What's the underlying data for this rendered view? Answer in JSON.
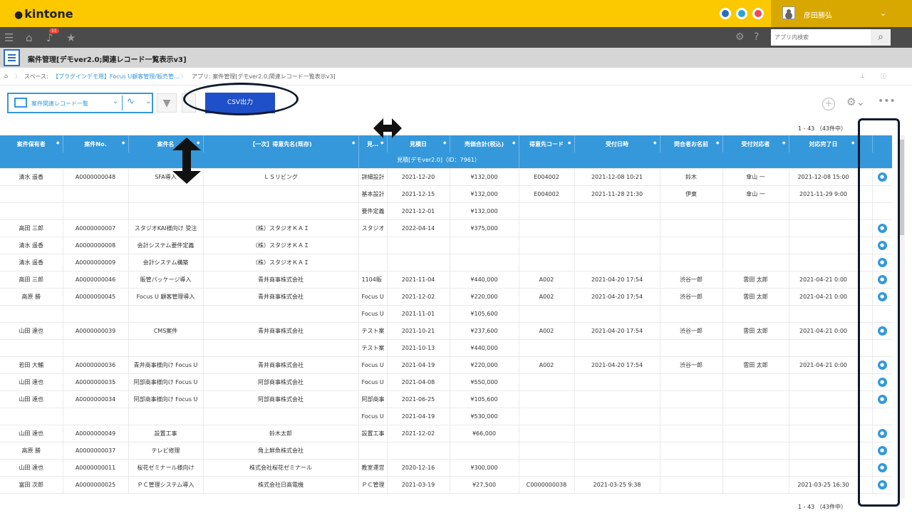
{
  "topbar": {
    "logo": "kintone",
    "user_name": "彦田勝弘",
    "chevron": "⌄"
  },
  "navbar": {
    "badge": "11",
    "search_placeholder": "アプリ内検索"
  },
  "app": {
    "title": "案件管理[デモver2.0;関連レコード一覧表示v3]"
  },
  "breadcrumb": {
    "space_label": "スペース:",
    "space_link": "【プラグインデモ用】Focus U顧客管理/販売管…",
    "app_label": "アプリ: 案件管理[デモver2.0;関連レコード一覧表示v3]"
  },
  "toolbar": {
    "view_name": "案件関連レコード一覧",
    "csv_label": "CSV出力"
  },
  "counts": {
    "top": "1 - 43 （43件中）",
    "bottom": "1 - 43 （43件中）"
  },
  "table": {
    "headers": [
      "案件保有者",
      "案件No.",
      "案件名",
      "↓",
      "【一次】得意先名(既存)",
      "見…",
      "見積日",
      "売価合計(税込)",
      "得意先コード",
      "受付日時",
      "問合者お名前",
      "受付対応者",
      "対応完了日",
      "",
      ""
    ],
    "subheader": "見積[デモver2.0]（ID：7961）",
    "rows": [
      [
        "清水 遥香",
        "A0000000048",
        "SFA導入",
        "",
        "ＬＳリビング",
        "詳細設計",
        "2021-12-20",
        "¥132,000",
        "E004002",
        "2021-12-08 10:21",
        "鈴木",
        "傘山 一",
        "2021-12-08 15:00",
        "",
        "●"
      ],
      [
        "",
        "",
        "",
        "",
        "",
        "基本設計",
        "2021-12-15",
        "¥132,000",
        "E004002",
        "2021-11-28 21:30",
        "伊東",
        "傘山 一",
        "2021-11-29 9:00",
        "",
        ""
      ],
      [
        "",
        "",
        "",
        "",
        "",
        "要件定義",
        "2021-12-01",
        "¥132,000",
        "",
        "",
        "",
        "",
        "",
        "",
        ""
      ],
      [
        "高田 三郎",
        "A0000000007",
        "スタジオKAI様向け 受注",
        "",
        "（株）スタジオＫＡＩ",
        "スタジオ",
        "2022-04-14",
        "¥375,000",
        "",
        "",
        "",
        "",
        "",
        "",
        "●"
      ],
      [
        "清水 遥香",
        "A0000000008",
        "会計システム要件定義",
        "",
        "（株）スタジオＫＡＩ",
        "",
        "",
        "",
        "",
        "",
        "",
        "",
        "",
        "",
        "●"
      ],
      [
        "清水 遥香",
        "A0000000009",
        "会計システム構築",
        "",
        "（株）スタジオＫＡＩ",
        "",
        "",
        "",
        "",
        "",
        "",
        "",
        "",
        "",
        "●"
      ],
      [
        "高田 三郎",
        "A0000000046",
        "販管パッケージ導入",
        "",
        "青井商事株式会社",
        "1104販",
        "2021-11-04",
        "¥440,000",
        "A002",
        "2021-04-20 17:54",
        "渋谷一郎",
        "雲田 太郎",
        "2021-04-21 0:00",
        "",
        "●"
      ],
      [
        "高原 勝",
        "A0000000045",
        "Focus U 顧客管理導入",
        "",
        "青井商事株式会社",
        "Focus U",
        "2021-12-02",
        "¥220,000",
        "A002",
        "2021-04-20 17:54",
        "渋谷一郎",
        "雲田 太郎",
        "2021-04-21 0:00",
        "",
        "●"
      ],
      [
        "",
        "",
        "",
        "",
        "",
        "Focus U",
        "2021-11-01",
        "¥105,600",
        "",
        "",
        "",
        "",
        "",
        "",
        ""
      ],
      [
        "山田 達也",
        "A0000000039",
        "CMS案件",
        "",
        "青井商事株式会社",
        "テスト案",
        "2021-10-21",
        "¥237,600",
        "A002",
        "2021-04-20 17:54",
        "渋谷一郎",
        "雲田 太郎",
        "2021-04-21 0:00",
        "",
        "●"
      ],
      [
        "",
        "",
        "",
        "",
        "",
        "テスト案",
        "2021-10-13",
        "¥440,000",
        "",
        "",
        "",
        "",
        "",
        "",
        ""
      ],
      [
        "若田 大輔",
        "A0000000036",
        "青井商事様向け Focus U",
        "",
        "青井商事株式会社",
        "Focus U",
        "2021-04-19",
        "¥220,000",
        "A002",
        "2021-04-20 17:54",
        "渋谷一郎",
        "雲田 太郎",
        "2021-04-21 0:00",
        "",
        "●"
      ],
      [
        "山田 達也",
        "A0000000035",
        "阿部商事様向け Focus U",
        "",
        "阿部商事株式会社",
        "Focus U",
        "2021-04-08",
        "¥550,000",
        "",
        "",
        "",
        "",
        "",
        "",
        "●"
      ],
      [
        "山田 達也",
        "A0000000034",
        "阿部商事様向け Focus U",
        "",
        "阿部商事株式会社",
        "阿部商事",
        "2021-06-25",
        "¥105,600",
        "",
        "",
        "",
        "",
        "",
        "",
        "●"
      ],
      [
        "",
        "",
        "",
        "",
        "",
        "Focus U",
        "2021-04-19",
        "¥530,000",
        "",
        "",
        "",
        "",
        "",
        "",
        ""
      ],
      [
        "山田 達也",
        "A0000000049",
        "設置工事",
        "",
        "鈴木太郎",
        "設置工事",
        "2021-12-02",
        "¥66,000",
        "",
        "",
        "",
        "",
        "",
        "",
        "●"
      ],
      [
        "高原 勝",
        "A0000000037",
        "テレビ修理",
        "",
        "角上鮮魚株式会社",
        "",
        "",
        "",
        "",
        "",
        "",
        "",
        "",
        "",
        "●"
      ],
      [
        "山田 達也",
        "A0000000011",
        "桜花ゼミナール様向け",
        "",
        "株式会社桜花ゼミナール",
        "教室運営",
        "2020-12-16",
        "¥300,000",
        "",
        "",
        "",
        "",
        "",
        "",
        "●"
      ],
      [
        "富田 次郎",
        "A0000000025",
        "ＰＣ管理システム導入",
        "",
        "株式会社日高電機",
        "ＰＣ管理",
        "2021-03-19",
        "¥27,500",
        "C0000000038",
        "2021-03-25 9:38",
        "",
        "",
        "2021-03-25 16:30",
        "",
        "●"
      ]
    ]
  },
  "colors": {
    "topbar": "#fcc800",
    "header": "#3498db",
    "csv_button": "#1f4fc9",
    "annotation": "#0d1a2b"
  }
}
